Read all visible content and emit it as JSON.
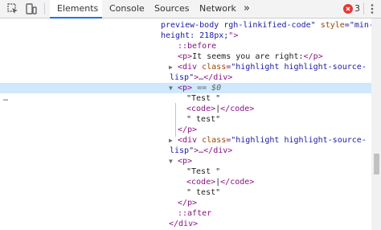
{
  "toolbar": {
    "inspect_icon": "inspect-element-icon",
    "device_icon": "device-toolbar-icon",
    "tabs": [
      {
        "label": "Elements",
        "active": true
      },
      {
        "label": "Console",
        "active": false
      },
      {
        "label": "Sources",
        "active": false
      },
      {
        "label": "Network",
        "active": false
      }
    ],
    "more_tabs_label": "»",
    "error_count": "3",
    "error_color": "#e53935",
    "menu_icon": "kebab-menu-icon",
    "accent": "#1a73e8"
  },
  "tree": {
    "selected_marker": "…",
    "lines": {
      "l1_text": "preview-body rgh-linkified-code\" ",
      "l1_attr": "style",
      "l1_eq": "=\"min-",
      "l2_val": "height: 218px;",
      "l2_end": "\">",
      "l3": "::before",
      "l4_open": "<p>",
      "l4_text": "It seems you are right:",
      "l4_close": "</p>",
      "l5_open": "<div ",
      "l5_attr": "class",
      "l5_val": "\"highlight highlight-source-",
      "l6_val": "lisp\"",
      "l6_end": ">…</div>",
      "l7_open": "<p>",
      "l7_eq": " == $0",
      "l8": "\"Test \"",
      "l9_open": "<code>",
      "l9_mid": "|",
      "l9_close": "</code>",
      "l10": "\" test\"",
      "l11": "</p>",
      "l12_open": "<div ",
      "l12_attr": "class",
      "l12_val": "\"highlight highlight-source-",
      "l13_val": "lisp\"",
      "l13_end": ">…</div>",
      "l14_open": "<p>",
      "l15": "\"Test \"",
      "l16_open": "<code>",
      "l16_mid": "|",
      "l16_close": "</code>",
      "l17": "\" test\"",
      "l18": "</p>",
      "l19": "::after",
      "l20": "</div>"
    }
  },
  "colors": {
    "tag": "#881280",
    "attr": "#994500",
    "value": "#1a1aa6",
    "selected_row": "#cfe8fc"
  }
}
